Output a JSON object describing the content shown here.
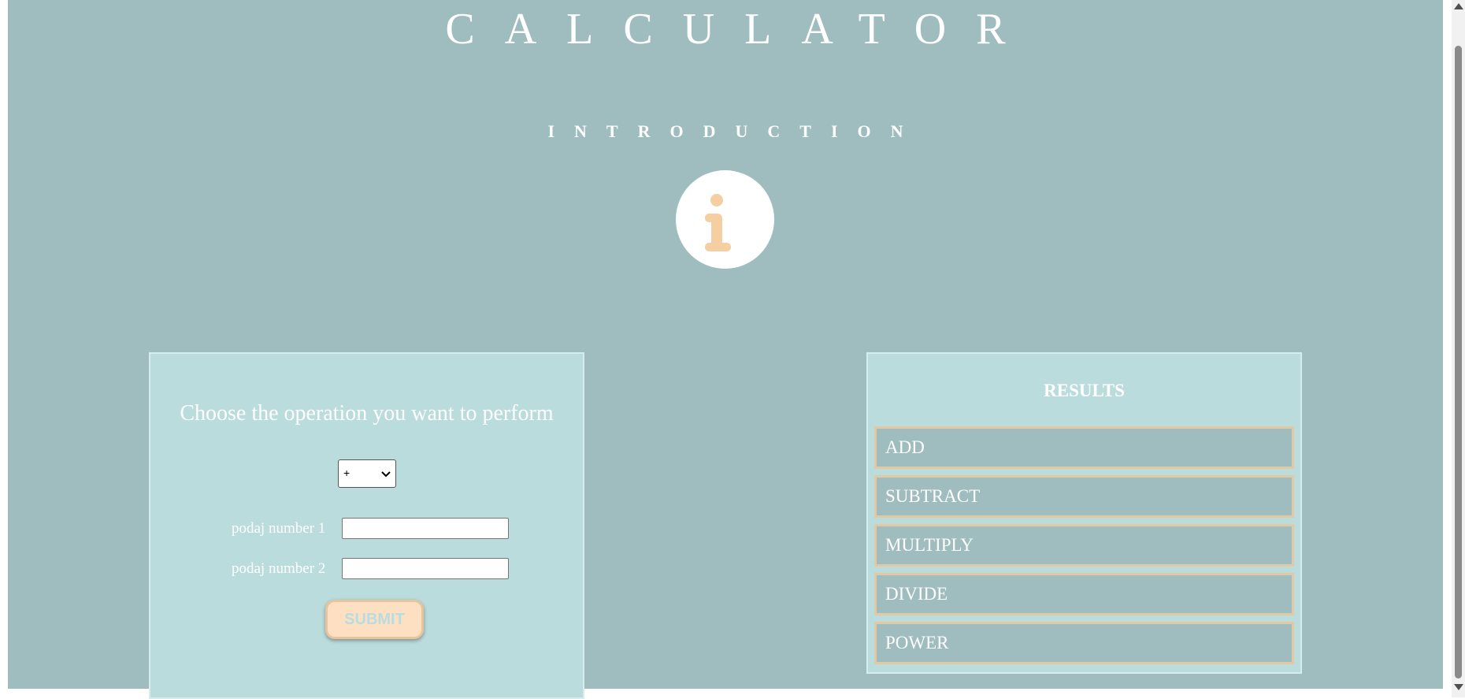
{
  "header": {
    "title": "CALCULATOR",
    "subtitle": "INTRODUCTION",
    "info_icon": "info-icon"
  },
  "form": {
    "heading": "Choose the operation you want to perform",
    "operation_select": {
      "selected": "+",
      "icon": "chevron-down-icon"
    },
    "number1_label": "podaj number 1",
    "number1_value": "",
    "number2_label": "podaj number 2",
    "number2_value": "",
    "submit_label": "SUBMIT"
  },
  "results": {
    "heading": "RESULTS",
    "items": [
      {
        "label": "ADD"
      },
      {
        "label": "SUBTRACT"
      },
      {
        "label": "MULTIPLY"
      },
      {
        "label": "DIVIDE"
      },
      {
        "label": "POWER"
      }
    ]
  },
  "colors": {
    "page_background": "#9fbdbe",
    "panel_background": "#badcdc",
    "accent_peach": "#f5cfa2",
    "text": "#ffffff"
  }
}
